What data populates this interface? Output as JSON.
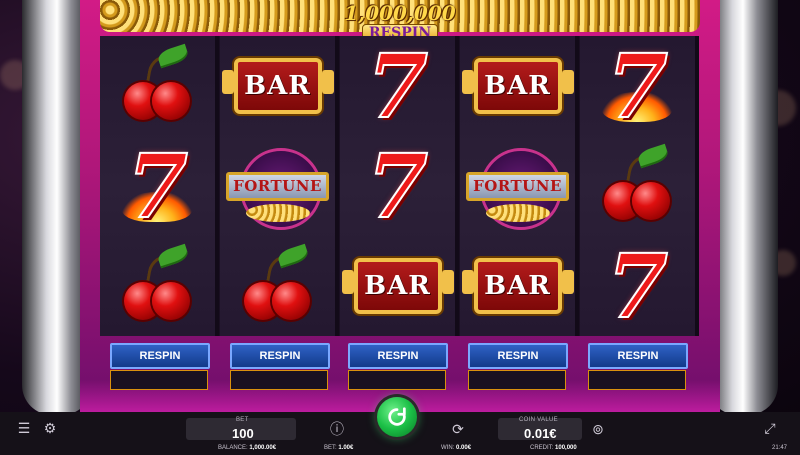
{
  "jackpot": {
    "amount": "1,000,000",
    "label": "RESPIN"
  },
  "reels": [
    [
      "cherries",
      "seven-flame",
      "cherries"
    ],
    [
      "bar",
      "fortune",
      "cherries"
    ],
    [
      "seven",
      "seven",
      "bar"
    ],
    [
      "bar",
      "fortune",
      "bar"
    ],
    [
      "seven-flame",
      "cherries",
      "seven"
    ]
  ],
  "symbol_text": {
    "bar": "BAR",
    "fortune": "FORTUNE"
  },
  "respin_buttons": [
    "RESPIN",
    "RESPIN",
    "RESPIN",
    "RESPIN",
    "RESPIN"
  ],
  "bottom": {
    "bet_label": "BET",
    "bet_value": "100",
    "coin_value_label": "COIN VALUE",
    "coin_value": "0.01€",
    "balance_label": "BALANCE:",
    "balance": "1,000.00€",
    "status_bet_label": "BET:",
    "status_bet": "1.00€",
    "win_label": "WIN:",
    "win": "0.00€",
    "credit_label": "CREDIT:",
    "credit": "100,000",
    "clock": "21:47"
  },
  "icons": {
    "menu": "menu-icon",
    "settings": "sliders-icon",
    "info": "info-icon",
    "spin": "spin-icon",
    "autoplay": "autoplay-icon",
    "coin": "coin-icon",
    "fullscreen": "fullscreen-icon"
  },
  "colors": {
    "frame_pink": "#d21b86",
    "respin_blue": "#2f62c6",
    "spin_green": "#1bbf46",
    "seven_red": "#ee1a1a"
  }
}
